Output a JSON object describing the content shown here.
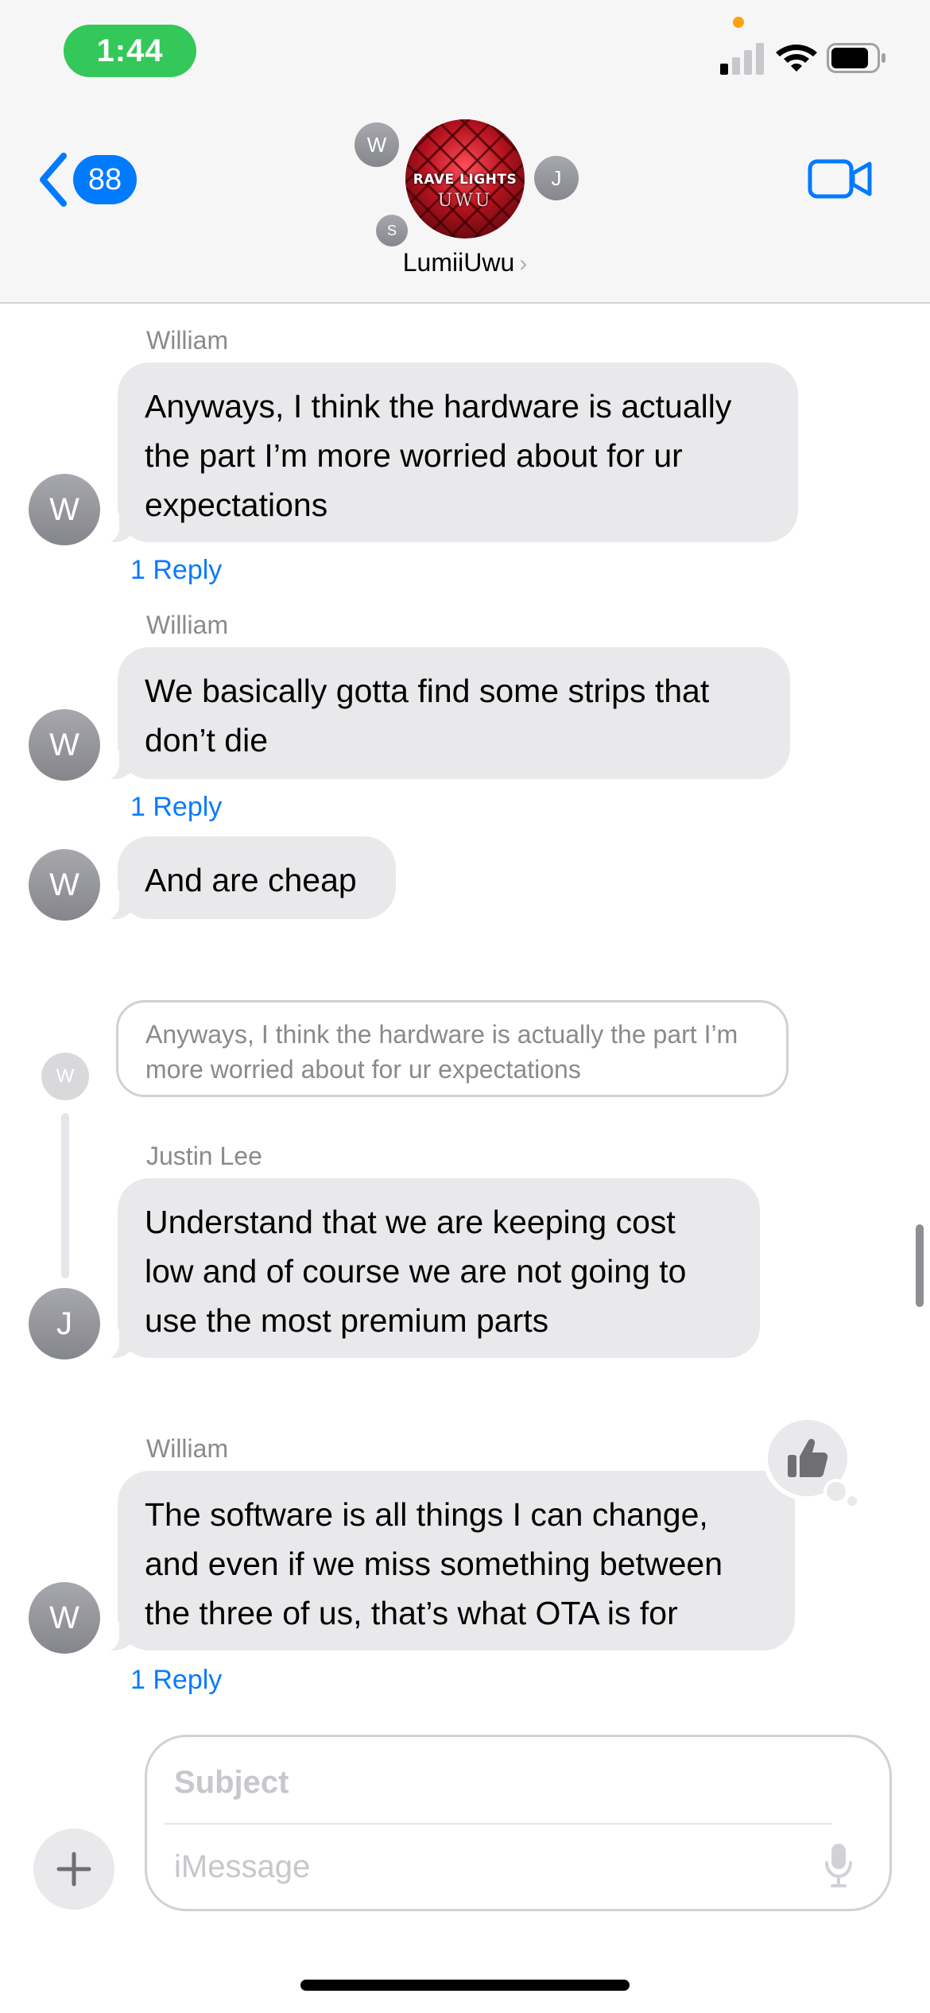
{
  "status_bar": {
    "time": "1:44"
  },
  "header": {
    "back_count": "88",
    "group_name": "LumiiUwu",
    "group_name_chevron": "›",
    "avatar_logo_top": "RAVE LIGHTS",
    "avatar_logo_bottom": "UWU",
    "member_initials": [
      "W",
      "J",
      "S"
    ]
  },
  "messages": [
    {
      "sender": "William",
      "initial": "W",
      "text": "Anyways, I think the hardware is actually the part I’m more worried about for ur expectations",
      "reply": "1 Reply"
    },
    {
      "sender": "William",
      "initial": "W",
      "text": "We basically gotta find some strips that don’t die",
      "reply": "1 Reply"
    },
    {
      "initial": "W",
      "text": "And are cheap"
    }
  ],
  "thread": {
    "quote_initial": "W",
    "quote_text": "Anyways, I think the hardware is actually the part I’m more worried about for ur expectations",
    "sender": "Justin Lee",
    "initial": "J",
    "text": "Understand that we are keeping cost low and of course we are not going to use the most premium parts"
  },
  "last_message": {
    "sender": "William",
    "initial": "W",
    "text": "The software is all things I can change, and even if we miss something between the three of us, that’s what OTA is for",
    "reply": "1 Reply",
    "tapback": "thumbs-up-icon"
  },
  "composer": {
    "subject_placeholder": "Subject",
    "message_placeholder": "iMessage"
  },
  "colors": {
    "accent": "#007aff",
    "status_pill": "#34c759",
    "bubble": "#e9e9eb",
    "sender_text": "#8a8a8e"
  }
}
